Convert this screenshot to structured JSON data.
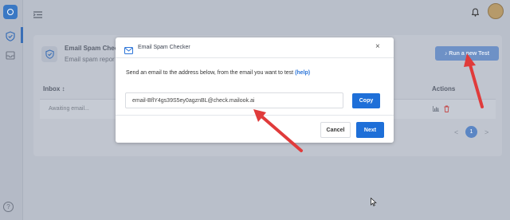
{
  "background": {
    "card_title": "Email Spam Checke",
    "card_subtitle": "Email spam repor",
    "run_button": "♪ Run a new Test",
    "table_header_inbox": "Inbox ↕",
    "table_header_actions": "Actions",
    "row_status": "Awaiting email...",
    "pagination": {
      "prev": "<",
      "current": "1",
      "next": ">"
    }
  },
  "modal": {
    "title": "Email Spam Checker",
    "close": "×",
    "description": "Send an email to the address below, from the email you want to test",
    "help_link": "(help)",
    "email_value": "email-BflY4gs39S5ey0agznBL@check.mailook.ai",
    "copy_button": "Copy",
    "cancel_button": "Cancel",
    "next_button": "Next"
  },
  "colors": {
    "primary": "#1e6fd8",
    "arrow": "#e03b3b"
  },
  "icons": [
    "app-logo-icon",
    "shield-check-icon",
    "inbox-icon",
    "menu-icon",
    "bell-icon",
    "avatar",
    "mail-icon",
    "close-icon",
    "help-icon",
    "bar-chart-icon",
    "trash-icon"
  ]
}
